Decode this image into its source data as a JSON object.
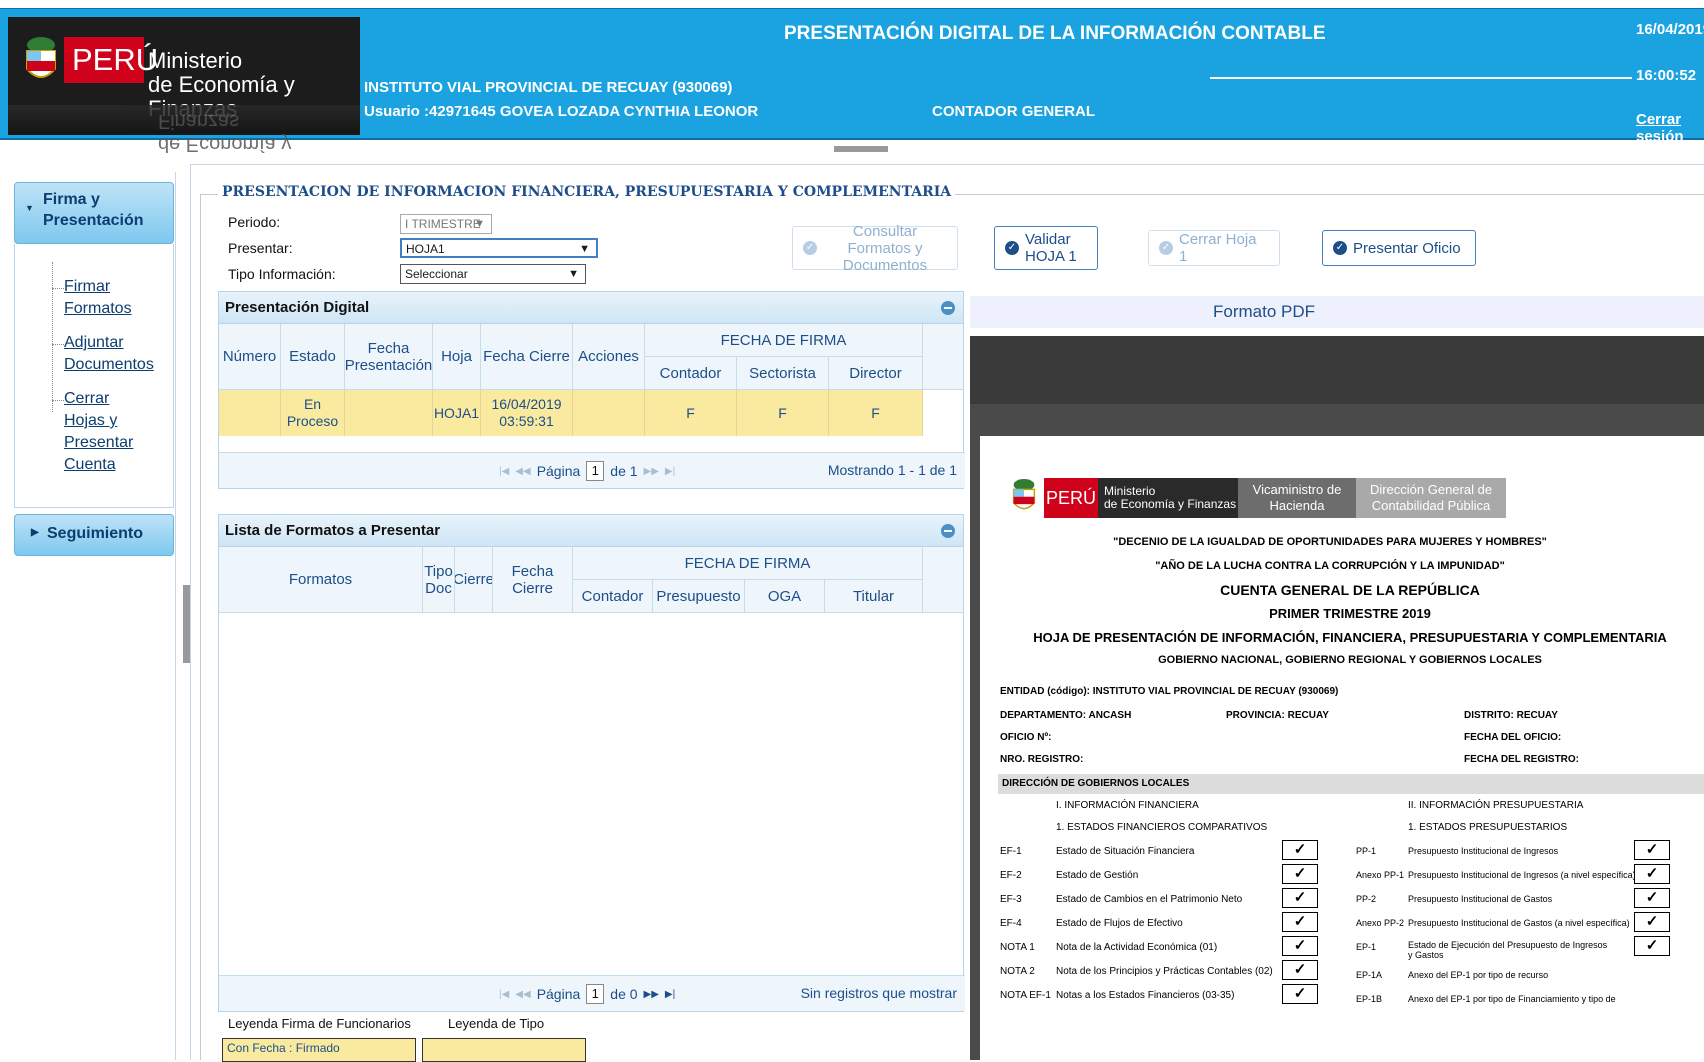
{
  "header": {
    "logo_country": "PERÚ",
    "logo_ministry_line1": "Ministerio",
    "logo_ministry_line2": "de Economía y Finanzas",
    "title": "PRESENTACIÓN DIGITAL DE LA INFORMACIÓN CONTABLE",
    "entity": "INSTITUTO VIAL PROVINCIAL DE RECUAY (930069)",
    "user": "Usuario :42971645 GOVEA LOZADA CYNTHIA LEONOR",
    "role": "CONTADOR GENERAL",
    "date": "16/04/2019",
    "time": "16:00:52",
    "logout": "Cerrar sesión"
  },
  "sidebar": {
    "section1": "Firma y\nPresentación",
    "items": [
      {
        "label": "Firmar Formatos"
      },
      {
        "label": "Adjuntar Documentos"
      },
      {
        "label": "Cerrar Hojas y Presentar Cuenta"
      }
    ],
    "section2": "Seguimiento"
  },
  "form": {
    "legend": "PRESENTACION DE INFORMACION FINANCIERA, PRESUPUESTARIA Y COMPLEMENTARIA",
    "periodo_label": "Periodo:",
    "periodo_value": "I TRIMESTRE",
    "presentar_label": "Presentar:",
    "presentar_value": "HOJA1",
    "tipo_label": "Tipo Información:",
    "tipo_value": "Seleccionar"
  },
  "buttons": {
    "consultar": "Consultar Formatos y Documentos",
    "validar": "Validar HOJA 1",
    "cerrar_hoja": "Cerrar Hoja 1",
    "presentar_oficio": "Presentar Oficio"
  },
  "presentacion": {
    "title": "Presentación Digital",
    "headers": [
      "Número",
      "Estado",
      "Fecha Presentación",
      "Hoja",
      "Fecha Cierre",
      "Acciones"
    ],
    "firma_group": "FECHA DE FIRMA",
    "firma_headers": [
      "Contador",
      "Sectorista",
      "Director"
    ],
    "row": {
      "numero": "",
      "estado": "En Proceso",
      "fecha_presentacion": "",
      "hoja": "HOJA1",
      "fecha_cierre": "16/04/2019 03:59:31",
      "acciones": "",
      "contador": "F",
      "sectorista": "F",
      "director": "F"
    },
    "pager_label": "Página",
    "page": "1",
    "of": "de 1",
    "msg": "Mostrando 1 - 1 de 1"
  },
  "formatos": {
    "title": "Lista de Formatos a Presentar",
    "headers": [
      "Formatos",
      "Tipo Doc",
      "Cierre",
      "Fecha Cierre"
    ],
    "firma_group": "FECHA DE FIRMA",
    "firma_headers": [
      "Contador",
      "Presupuesto",
      "OGA",
      "Titular"
    ],
    "pager_label": "Página",
    "page": "1",
    "of": "de 0",
    "msg": "Sin registros que mostrar"
  },
  "leyenda": {
    "firma_title": "Leyenda Firma de Funcionarios",
    "tipo_title": "Leyenda de Tipo",
    "firma_item": "Con Fecha : Firmado"
  },
  "pdf": {
    "title": "Formato PDF",
    "logo_country": "PERÚ",
    "logo_min1": "Ministerio",
    "logo_min2": "de Economía y Finanzas",
    "vice1": "Vicaministro de",
    "vice2": "Hacienda",
    "dg1": "Dirección General de",
    "dg2": "Contabilidad Pública",
    "decenio": "\"DECENIO DE LA IGUALDAD DE OPORTUNIDADES PARA MUJERES Y HOMBRES\"",
    "anio": "\"AÑO DE LA LUCHA CONTRA LA CORRUPCIÓN Y LA IMPUNIDAD\"",
    "cuenta": "CUENTA GENERAL DE LA REPÚBLICA",
    "trimestre": "PRIMER TRIMESTRE 2019",
    "hoja": "HOJA DE PRESENTACIÓN DE INFORMACIÓN, FINANCIERA, PRESUPUESTARIA Y COMPLEMENTARIA",
    "gobierno": "GOBIERNO NACIONAL, GOBIERNO REGIONAL Y GOBIERNOS LOCALES",
    "entidad": "ENTIDAD (código):   INSTITUTO VIAL PROVINCIAL DE RECUAY (930069)",
    "departamento": "DEPARTAMENTO:  ANCASH",
    "provincia": "PROVINCIA:  RECUAY",
    "distrito": "DISTRITO:   RECUAY",
    "oficio": "OFICIO Nº:",
    "fecha_oficio": "FECHA DEL OFICIO:",
    "registro": "NRO. REGISTRO:",
    "fecha_registro": "FECHA DEL REGISTRO:",
    "direccion": "DIRECCIÓN DE GOBIERNOS LOCALES",
    "info_fin": "I. INFORMACIÓN FINANCIERA",
    "info_pres": "II. INFORMACIÓN PRESUPUESTARIA",
    "estados_fin": "1. ESTADOS FINANCIEROS COMPARATIVOS",
    "estados_pres": "1. ESTADOS PRESUPUESTARIOS",
    "left_rows": [
      {
        "code": "EF-1",
        "name": "Estado de Situación Financiera"
      },
      {
        "code": "EF-2",
        "name": "Estado de Gestión"
      },
      {
        "code": "EF-3",
        "name": "Estado de Cambios en el Patrimonio Neto"
      },
      {
        "code": "EF-4",
        "name": "Estado de Flujos de Efectivo"
      },
      {
        "code": "NOTA 1",
        "name": "Nota de la Actividad Económica (01)"
      },
      {
        "code": "NOTA 2",
        "name": "Nota de los Principios y Prácticas Contables (02)"
      },
      {
        "code": "NOTA EF-1",
        "name": "Notas a los Estados Financieros (03-35)"
      }
    ],
    "right_rows": [
      {
        "code": "PP-1",
        "name": "Presupuesto Institucional de Ingresos"
      },
      {
        "code": "Anexo PP-1",
        "name": "Presupuesto Institucional de Ingresos (a nivel específica)"
      },
      {
        "code": "PP-2",
        "name": "Presupuesto Institucional de Gastos"
      },
      {
        "code": "Anexo PP-2",
        "name": "Presupuesto Institucional de Gastos (a nivel específica)"
      },
      {
        "code": "EP-1",
        "name": "Estado de Ejecución del Presupuesto de Ingresos y Gastos"
      },
      {
        "code": "EP-1A",
        "name": "Anexo del EP-1 por tipo de recurso"
      },
      {
        "code": "EP-1B",
        "name": "Anexo del EP-1 por tipo de Financiamiento y tipo de"
      }
    ],
    "check": "✓"
  }
}
